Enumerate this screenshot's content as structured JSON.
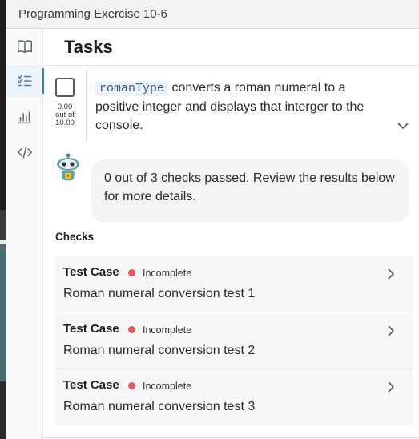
{
  "window": {
    "title": "Programming Exercise 10-6"
  },
  "rail": {
    "items": [
      {
        "icon": "book-icon"
      },
      {
        "icon": "checklist-icon",
        "active": true
      },
      {
        "icon": "bar-chart-icon"
      },
      {
        "icon": "code-icon"
      }
    ]
  },
  "header": {
    "title": "Tasks"
  },
  "task": {
    "score_value": "0.00",
    "score_outof": "out of",
    "score_total": "10.00",
    "code": "romanType",
    "description": " converts a roman numeral to a positive integer and displays that interger to the console."
  },
  "assistant": {
    "message": "0 out of 3 checks passed. Review the results below for more details."
  },
  "checks": {
    "title": "Checks",
    "items": [
      {
        "label": "Test Case",
        "status": "Incomplete",
        "name": "Roman numeral conversion test 1"
      },
      {
        "label": "Test Case",
        "status": "Incomplete",
        "name": "Roman numeral conversion test 2"
      },
      {
        "label": "Test Case",
        "status": "Incomplete",
        "name": "Roman numeral conversion test 3"
      }
    ]
  },
  "colors": {
    "accent": "#3b7bd6",
    "incomplete": "#e35a5a"
  }
}
